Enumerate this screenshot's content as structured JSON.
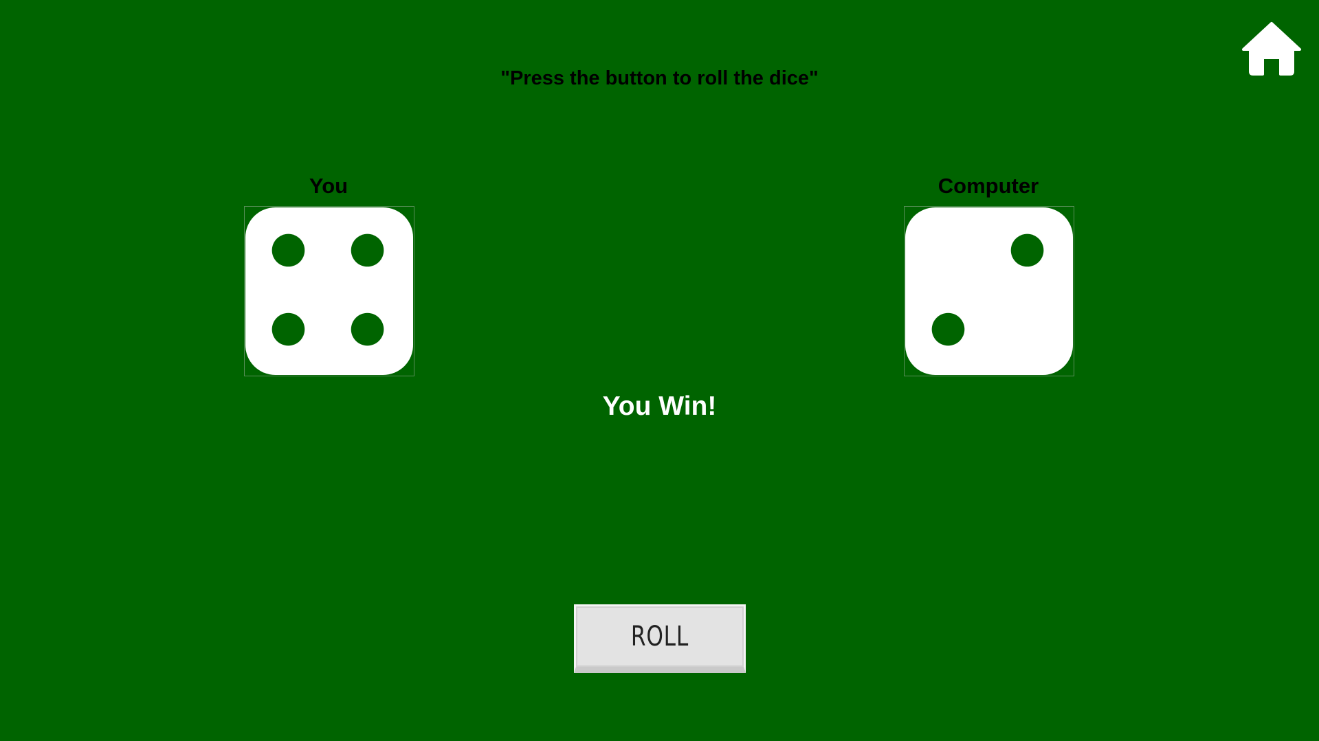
{
  "game": {
    "instruction": "\"Press the button to roll the dice\"",
    "result": "You Win!",
    "roll_label": "ROLL"
  },
  "players": {
    "you": {
      "label": "You",
      "die_value": 4
    },
    "computer": {
      "label": "Computer",
      "die_value": 2
    }
  },
  "icons": {
    "home": "home-icon"
  },
  "colors": {
    "table_background": "#006400",
    "die_face": "#ffffff",
    "pip": "#006400",
    "result_text": "#ffffff",
    "button_face": "#e3e3e3"
  }
}
